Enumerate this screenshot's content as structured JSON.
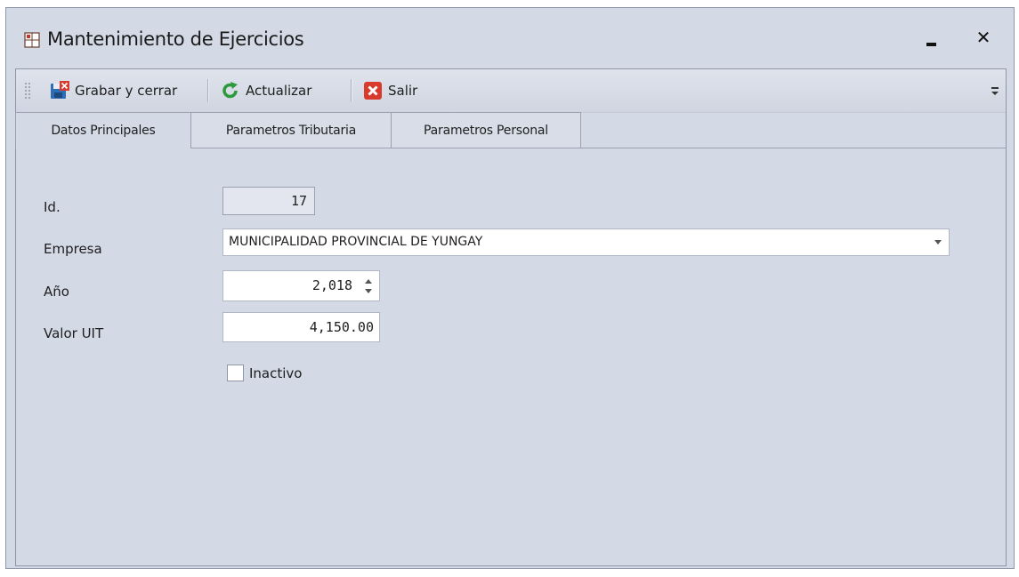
{
  "window": {
    "title": "Mantenimiento de Ejercicios",
    "icon": "form-icon",
    "minimize_icon": "minimize-icon",
    "close_label": "✕"
  },
  "toolbar": {
    "items": [
      {
        "label": "Grabar y cerrar",
        "icon": "save-close-icon"
      },
      {
        "label": "Actualizar",
        "icon": "refresh-icon"
      },
      {
        "label": "Salir",
        "icon": "exit-icon"
      }
    ],
    "more_icon": "toolbar-options-icon"
  },
  "tabs": [
    {
      "label": "Datos Principales",
      "active": true
    },
    {
      "label": "Parametros Tributaria",
      "active": false
    },
    {
      "label": "Parametros Personal",
      "active": false
    }
  ],
  "form": {
    "id_label": "Id.",
    "id_value": "17",
    "empresa_label": "Empresa",
    "empresa_value": "MUNICIPALIDAD PROVINCIAL DE YUNGAY",
    "anio_label": "Año",
    "anio_value": "2,018",
    "uit_label": "Valor  UIT",
    "uit_value": "4,150.00",
    "inactivo_label": "Inactivo",
    "inactivo_checked": false
  },
  "colors": {
    "window_bg": "#d4d9e6",
    "border": "#8e96a8",
    "save_icon": "#2d6fb5",
    "refresh_icon": "#2a9a3a",
    "exit_icon": "#d83a2e"
  }
}
